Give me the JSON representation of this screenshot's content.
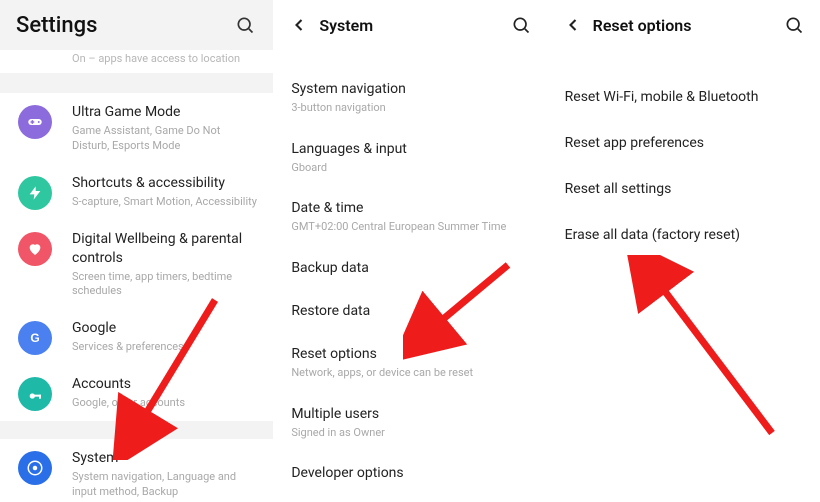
{
  "screen1": {
    "title": "Settings",
    "partial_item_sub": "On – apps have access to location",
    "items": [
      {
        "icon": "gamepad",
        "color": "ic-purple",
        "label": "Ultra Game Mode",
        "sub": "Game Assistant, Game Do Not Disturb, Esports Mode"
      },
      {
        "icon": "bolt",
        "color": "ic-teal",
        "label": "Shortcuts & accessibility",
        "sub": "S-capture, Smart Motion, Accessibility"
      },
      {
        "icon": "heart",
        "color": "ic-red",
        "label": "Digital Wellbeing & parental controls",
        "sub": "Screen time, app timers, bedtime schedules"
      },
      {
        "icon": "google",
        "color": "ic-blue",
        "label": "Google",
        "sub": "Services & preferences"
      },
      {
        "icon": "key",
        "color": "ic-tealkey",
        "label": "Accounts",
        "sub": "Google, other accounts"
      }
    ],
    "system_item": {
      "icon": "radial",
      "color": "ic-bluerad",
      "label": "System",
      "sub": "System navigation, Language and input method, Backup"
    }
  },
  "screen2": {
    "title": "System",
    "items": [
      {
        "label": "System navigation",
        "sub": "3-button navigation"
      },
      {
        "label": "Languages & input",
        "sub": "Gboard"
      },
      {
        "label": "Date & time",
        "sub": "GMT+02:00 Central European Summer Time"
      },
      {
        "label": "Backup data",
        "sub": ""
      },
      {
        "label": "Restore data",
        "sub": ""
      },
      {
        "label": "Reset options",
        "sub": "Network, apps, or device can be reset"
      },
      {
        "label": "Multiple users",
        "sub": "Signed in as Owner"
      },
      {
        "label": "Developer options",
        "sub": ""
      }
    ]
  },
  "screen3": {
    "title": "Reset options",
    "items": [
      {
        "label": "Reset Wi-Fi, mobile & Bluetooth"
      },
      {
        "label": "Reset app preferences"
      },
      {
        "label": "Reset all settings"
      },
      {
        "label": "Erase all data (factory reset)"
      }
    ]
  }
}
